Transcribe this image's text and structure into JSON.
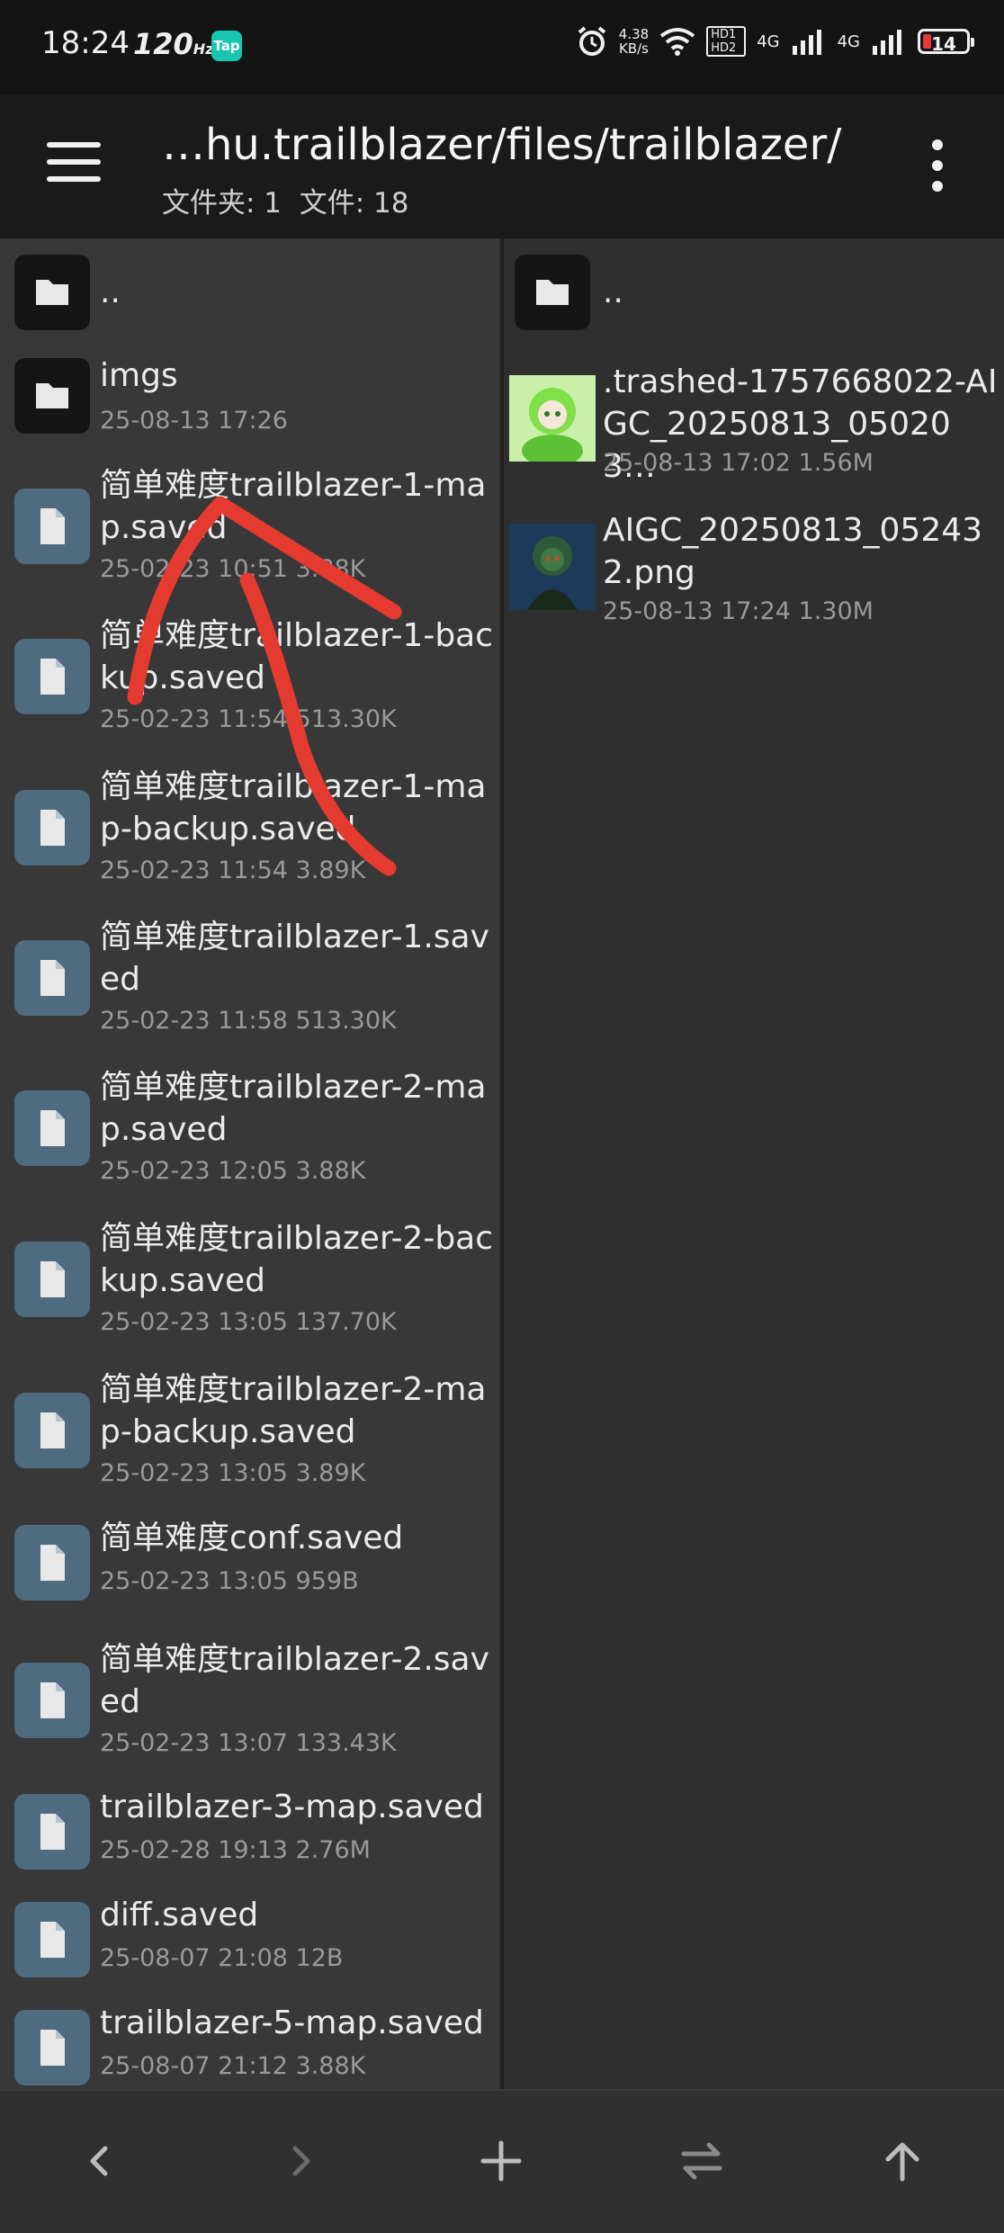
{
  "status_bar": {
    "time": "18:24",
    "refresh_rate": "120",
    "refresh_unit": "Hz",
    "app_badge": "Tap",
    "net_speed_value": "4.38",
    "net_speed_unit": "KB/s",
    "hd_badge": "HD1 HD2",
    "network_1": "4G",
    "network_2": "4G",
    "battery": "14"
  },
  "toolbar": {
    "path_title": "…hu.trailblazer/files/trailblazer/",
    "counts": "文件夹: 1  文件: 18"
  },
  "left_pane": {
    "parent_label": "..",
    "items": [
      {
        "name": "imgs",
        "meta": "25-08-13 17:26",
        "type": "folder"
      },
      {
        "name": "简单难度trailblazer-1-map.saved",
        "meta": "25-02-23 10:51  3.88K",
        "type": "file"
      },
      {
        "name": "简单难度trailblazer-1-backup.saved",
        "meta": "25-02-23 11:54  513.30K",
        "type": "file"
      },
      {
        "name": "简单难度trailblazer-1-map-backup.saved",
        "meta": "25-02-23 11:54  3.89K",
        "type": "file"
      },
      {
        "name": "简单难度trailblazer-1.saved",
        "meta": "25-02-23 11:58  513.30K",
        "type": "file"
      },
      {
        "name": "简单难度trailblazer-2-map.saved",
        "meta": "25-02-23 12:05  3.88K",
        "type": "file"
      },
      {
        "name": "简单难度trailblazer-2-backup.saved",
        "meta": "25-02-23 13:05  137.70K",
        "type": "file"
      },
      {
        "name": "简单难度trailblazer-2-map-backup.saved",
        "meta": "25-02-23 13:05  3.89K",
        "type": "file"
      },
      {
        "name": "简单难度conf.saved",
        "meta": "25-02-23 13:05  959B",
        "type": "file"
      },
      {
        "name": "简单难度trailblazer-2.saved",
        "meta": "25-02-23 13:07  133.43K",
        "type": "file"
      },
      {
        "name": "trailblazer-3-map.saved",
        "meta": "25-02-28 19:13  2.76M",
        "type": "file"
      },
      {
        "name": "diff.saved",
        "meta": "25-08-07 21:08  12B",
        "type": "file"
      },
      {
        "name": "trailblazer-5-map.saved",
        "meta": "25-08-07 21:12  3.88K",
        "type": "file"
      }
    ]
  },
  "right_pane": {
    "parent_label": "..",
    "items": [
      {
        "name": ".trashed-1757668022-AIGC_20250813_050203…",
        "meta": "25-08-13 17:02  1.56M",
        "thumb_color": "#7fe04a"
      },
      {
        "name": "AIGC_20250813_052432.png",
        "meta": "25-08-13 17:24  1.30M",
        "thumb_color": "#2f5a3a"
      }
    ]
  },
  "bottom_bar": {
    "icons": [
      "back-icon",
      "forward-icon",
      "add-icon",
      "swap-icon",
      "up-arrow-icon"
    ]
  },
  "colors": {
    "annotation_stroke": "#e53a2f",
    "file_icon_bg": "#4f6b80",
    "folder_icon_bg": "#151515"
  }
}
